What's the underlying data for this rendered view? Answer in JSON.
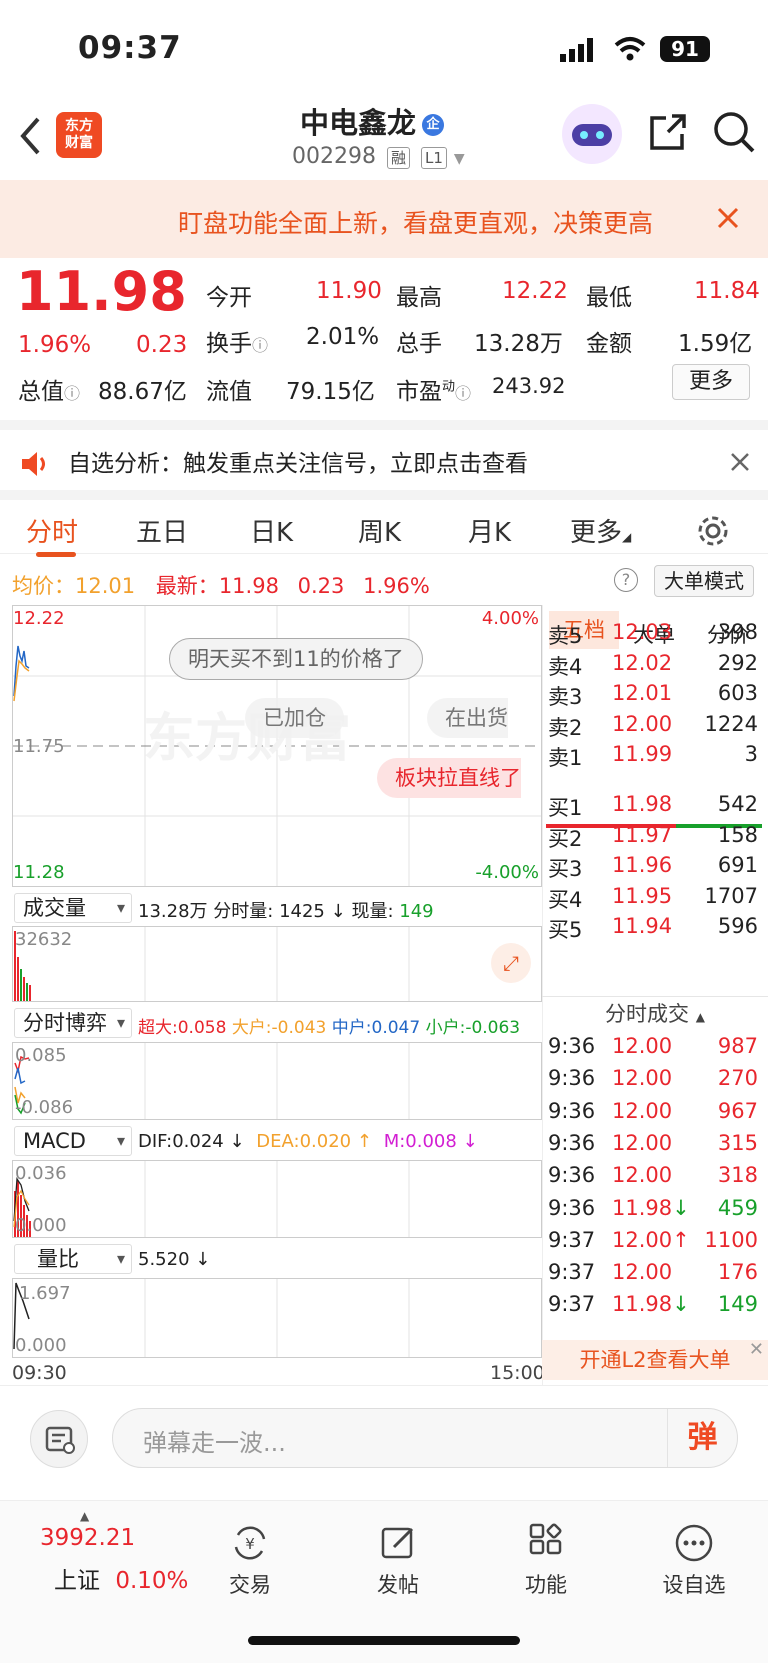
{
  "status_bar": {
    "time": "09:37",
    "battery": "91"
  },
  "nav": {
    "logo_line1": "东方",
    "logo_line2": "财富",
    "title": "中电鑫龙",
    "code": "002298",
    "tag1": "融",
    "tag2": "L1"
  },
  "banner": {
    "text": "盯盘功能全面上新，看盘更直观，决策更高"
  },
  "quote": {
    "price": "11.98",
    "change_pct": "1.96%",
    "change": "0.23",
    "open_label": "今开",
    "open": "11.90",
    "high_label": "最高",
    "high": "12.22",
    "low_label": "最低",
    "low": "11.84",
    "turnover_label": "换手",
    "turnover": "2.01%",
    "volume_label": "总手",
    "volume": "13.28万",
    "amount_label": "金额",
    "amount": "1.59亿",
    "mcap_label": "总值",
    "mcap": "88.67亿",
    "float_label": "流值",
    "float": "79.15亿",
    "pe_label": "市盈",
    "pe_sup": "动",
    "pe": "243.92",
    "more": "更多"
  },
  "notice": {
    "text": "自选分析：触发重点关注信号，立即点击查看"
  },
  "tabs": [
    "分时",
    "五日",
    "日K",
    "周K",
    "月K",
    "更多"
  ],
  "info_line": {
    "avg_label": "均价：",
    "avg": "12.01",
    "latest_label": "最新：",
    "latest": "11.98",
    "change": "0.23",
    "pct": "1.96%",
    "mode_button": "大单模式"
  },
  "main_chart": {
    "y_top": "12.22",
    "y_mid": "11.75",
    "y_bottom": "11.28",
    "pct_top": "4.00%",
    "pct_bottom": "-4.00%",
    "bubble1": "明天买不到11的价格了",
    "bubble2": "已加仓",
    "bubble3": "在出货",
    "bubble4": "板块拉直线了",
    "watermark": "东方财富"
  },
  "volume_panel": {
    "selector": "成交量",
    "total": "13.28万",
    "minute_label": "分时量:",
    "minute": "1425",
    "minute_arrow": "↓",
    "now_label": "现量:",
    "now": "149",
    "y_top": "32632"
  },
  "game_panel": {
    "selector": "分时博弈",
    "super_label": "超大:",
    "super": "0.058",
    "big_label": "大户:",
    "big": "-0.043",
    "mid_label": "中户:",
    "mid": "0.047",
    "small_label": "小户:",
    "small": "-0.063",
    "y_top": "0.085",
    "y_bottom": "-0.086"
  },
  "macd_panel": {
    "selector": "MACD",
    "dif_label": "DIF:",
    "dif": "0.024",
    "dif_arrow": "↓",
    "dea_label": "DEA:",
    "dea": "0.020",
    "dea_arrow": "↑",
    "m_label": "M:",
    "m": "0.008",
    "m_arrow": "↓",
    "y_top": "0.036",
    "y_bottom": "0.000"
  },
  "ratio_panel": {
    "selector": "量比",
    "value": "5.520",
    "arrow": "↓",
    "y_top": "1.697",
    "y_bottom": "0.000"
  },
  "time_axis": {
    "start": "09:30",
    "end": "15:00"
  },
  "orderbook": {
    "tabs": [
      "五档",
      "大单",
      "分价"
    ],
    "asks": [
      {
        "label": "卖5",
        "price": "12.03",
        "vol": "398"
      },
      {
        "label": "卖4",
        "price": "12.02",
        "vol": "292"
      },
      {
        "label": "卖3",
        "price": "12.01",
        "vol": "603"
      },
      {
        "label": "卖2",
        "price": "12.00",
        "vol": "1224"
      },
      {
        "label": "卖1",
        "price": "11.99",
        "vol": "3"
      }
    ],
    "bids": [
      {
        "label": "买1",
        "price": "11.98",
        "vol": "542"
      },
      {
        "label": "买2",
        "price": "11.97",
        "vol": "158"
      },
      {
        "label": "买3",
        "price": "11.96",
        "vol": "691"
      },
      {
        "label": "买4",
        "price": "11.95",
        "vol": "1707"
      },
      {
        "label": "买5",
        "price": "11.94",
        "vol": "596"
      }
    ],
    "ticks_header": "分时成交",
    "ticks": [
      {
        "time": "9:36",
        "price": "12.00",
        "vol": "987"
      },
      {
        "time": "9:36",
        "price": "12.00",
        "vol": "270"
      },
      {
        "time": "9:36",
        "price": "12.00",
        "vol": "967"
      },
      {
        "time": "9:36",
        "price": "12.00",
        "vol": "315"
      },
      {
        "time": "9:36",
        "price": "12.00",
        "vol": "318"
      },
      {
        "time": "9:36",
        "price": "11.98↓",
        "vol": "459"
      },
      {
        "time": "9:37",
        "price": "12.00↑",
        "vol": "1100"
      },
      {
        "time": "9:37",
        "price": "12.00",
        "vol": "176"
      },
      {
        "time": "9:37",
        "price": "11.98↓",
        "vol": "149"
      }
    ],
    "l2_promo": "开通L2查看大单"
  },
  "comment": {
    "placeholder": "弹幕走一波...",
    "send": "弹"
  },
  "bottom_nav": {
    "index_value": "3992.21",
    "index_name": "上证",
    "index_pct": "0.10%",
    "trade": "交易",
    "post": "发帖",
    "func": "功能",
    "watch": "设自选"
  },
  "colors": {
    "up": "#e8262d",
    "down": "#18a02b",
    "accent": "#e8531f",
    "avg_line": "#f2a12d"
  }
}
